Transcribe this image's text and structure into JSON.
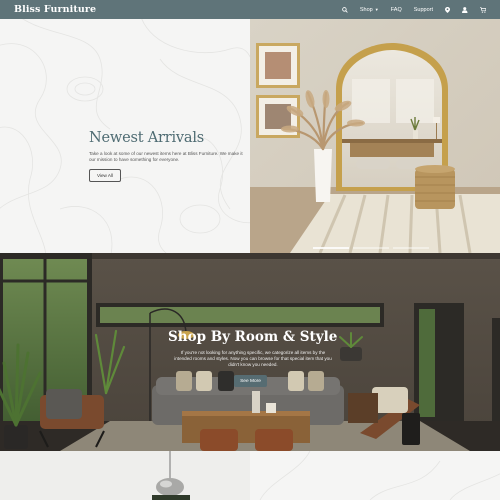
{
  "navbar": {
    "brand": "Bliss Furniture",
    "shop_label": "Shop",
    "faq_label": "FAQ",
    "support_label": "Support",
    "icons": [
      "search-icon",
      "chevron-down-icon",
      "location-pin-icon",
      "user-icon",
      "cart-icon"
    ]
  },
  "hero": {
    "title": "Newest Arrivals",
    "description": "Take a look at some of our newest items here at Bliss Furniture. We make it our mission to have something for everyone.",
    "button_label": "View All"
  },
  "room_section": {
    "title": "Shop By Room & Style",
    "description": "If you're not looking for anything specific, we categorize all items by the intended rooms and styles. Now you can browse for that special item that you didn't know you needed.",
    "button_label": "See More"
  },
  "colors": {
    "navbar": "#5f7479",
    "accent": "#4e6b72",
    "button": "#566c72"
  }
}
